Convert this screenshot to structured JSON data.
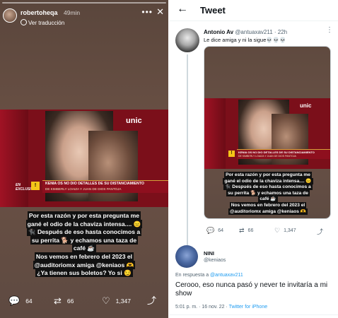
{
  "story": {
    "username": "robertoheqa",
    "time": "49min",
    "more_icon": "more-horizontal-icon",
    "close_icon": "close-icon",
    "translate_label": "Ver traducción",
    "tv": {
      "logo": "unic",
      "exclusive_label": "EN EXCLUSIVA",
      "headline": "KENIA OS NO DIO DETALLES DE SU DISTANCIAMIENTO",
      "subheadline": "DE KIMBERLY LOAIZA Y JUAN DE DIOS PANTOJA"
    },
    "caption_lines": [
      "Por esta razón y por esta pregunta me",
      "gané el odio de la chaviza intensa.... 😑",
      "🐈‍⬛ Después de eso hasta conocimos a",
      "su perrita 🐕 y echamos una taza de",
      "café ☕",
      "Nos vemos en febrero del 2023 el",
      "@auditoriomx amiga @keniaos 🫶",
      "¿Ya tienen sus boletos? Yo si 😏"
    ],
    "actions": {
      "replies": "64",
      "retweets": "66",
      "likes": "1,347"
    }
  },
  "tweet": {
    "header_title": "Tweet",
    "author_name": "Antonio Av",
    "author_handle": "@antuaxav211",
    "author_time": "· 22h",
    "text": "Le dice amiga y ni la sigue💀💀💀",
    "actions": {
      "replies": "64",
      "retweets": "66",
      "likes": "1,347"
    },
    "reply": {
      "name": "NINI",
      "handle": "@keniaos",
      "in_reply_prefix": "En respuesta a",
      "in_reply_handle": "@antuaxav211",
      "text": "Cerooo, eso nunca pasó y never te invitaría a mi show",
      "datetime": "5:01 p. m. · 16 nov. 22 ·",
      "source": "Twitter for iPhone"
    }
  },
  "colors": {
    "twitter_blue": "#1d9bf0",
    "tv_red": "#7b0f1a",
    "badge_yellow": "#f5c518"
  }
}
